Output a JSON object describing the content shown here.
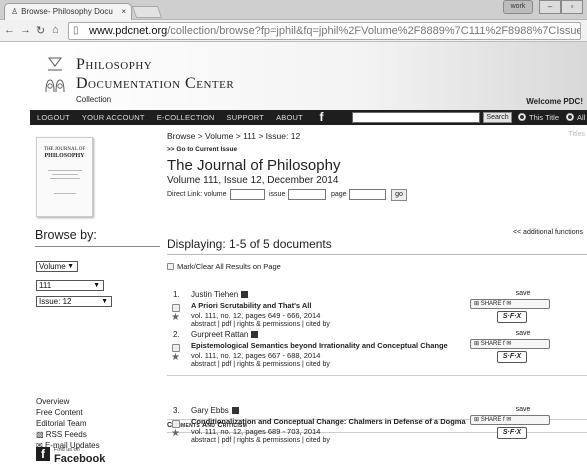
{
  "browser": {
    "tab_title": "Browse- Philosophy Docu",
    "tab_close": "×",
    "work_label": "work",
    "url_host": "www.pdcnet.org",
    "url_path": "/collection/browse?fp=jphil&fq=jphil%2FVolume%2F8889%7C111%2F8988%7CIssue%3A+12%2F"
  },
  "header": {
    "logo_line1": "Philosophy",
    "logo_line2": "Documentation Center",
    "subtitle": "Collection",
    "welcome": "Welcome PDC!"
  },
  "menu": {
    "items": [
      "LOGOUT",
      "YOUR ACCOUNT",
      "E-COLLECTION",
      "SUPPORT",
      "ABOUT"
    ],
    "fb_glyph": "f",
    "search_label": "Search",
    "radio_this_title": "This Title",
    "radio_all": "All"
  },
  "sidebar": {
    "cover": {
      "line1": "THE JOURNAL OF",
      "line2": "PHILOSOPHY"
    },
    "browse_by": "Browse by:",
    "select_type": "Volume",
    "select_volume": "111",
    "select_issue": "Issue: 12",
    "links": [
      "Overview",
      "Free Content",
      "Editorial Team",
      "RSS Feeds",
      "E-mail Updates"
    ],
    "facebook": {
      "find_us": "Find us on",
      "name": "Facebook"
    }
  },
  "main": {
    "breadcrumb": "Browse > Volume > 111 > Issue: 12",
    "goto": ">> Go to Current Issue",
    "journal_title": "The Journal of Philosophy",
    "volume_line": "Volume 111, Issue 12, December 2014",
    "direct_link": {
      "label": "Direct Link: volume",
      "issue_label": "issue",
      "page_label": "page",
      "go": "go"
    },
    "titles_label": "Titles",
    "additional_functions": "<< additional functions",
    "displaying": "Displaying: 1-5 of 5 documents",
    "mark_all": "Mark/Clear All Results on Page",
    "section_heading": "Comments And Criticism",
    "save_label": "save",
    "share_label": "SHARE",
    "sfx_label": "S·F·X",
    "articles": [
      {
        "num": "1.",
        "author": "Justin Tiehen",
        "title": "A Priori Scrutability and That's All",
        "meta": "vol. 111, no. 12, pages 649 - 666, 2014",
        "links": "abstract | pdf | rights & permissions | cited by"
      },
      {
        "num": "2.",
        "author": "Gurpreet Rattan",
        "title": "Epistemological Semantics beyond Irrationality and Conceptual Change",
        "meta": "vol. 111, no. 12, pages 667 - 688, 2014",
        "links": "abstract | pdf | rights & permissions | cited by"
      },
      {
        "num": "3.",
        "author": "Gary Ebbs",
        "title": "Conditionalization and Conceptual Change: Chalmers in Defense of a Dogma",
        "meta": "vol. 111, no. 12, pages 689 - 703, 2014",
        "links": "abstract | pdf | rights & permissions | cited by"
      }
    ]
  }
}
